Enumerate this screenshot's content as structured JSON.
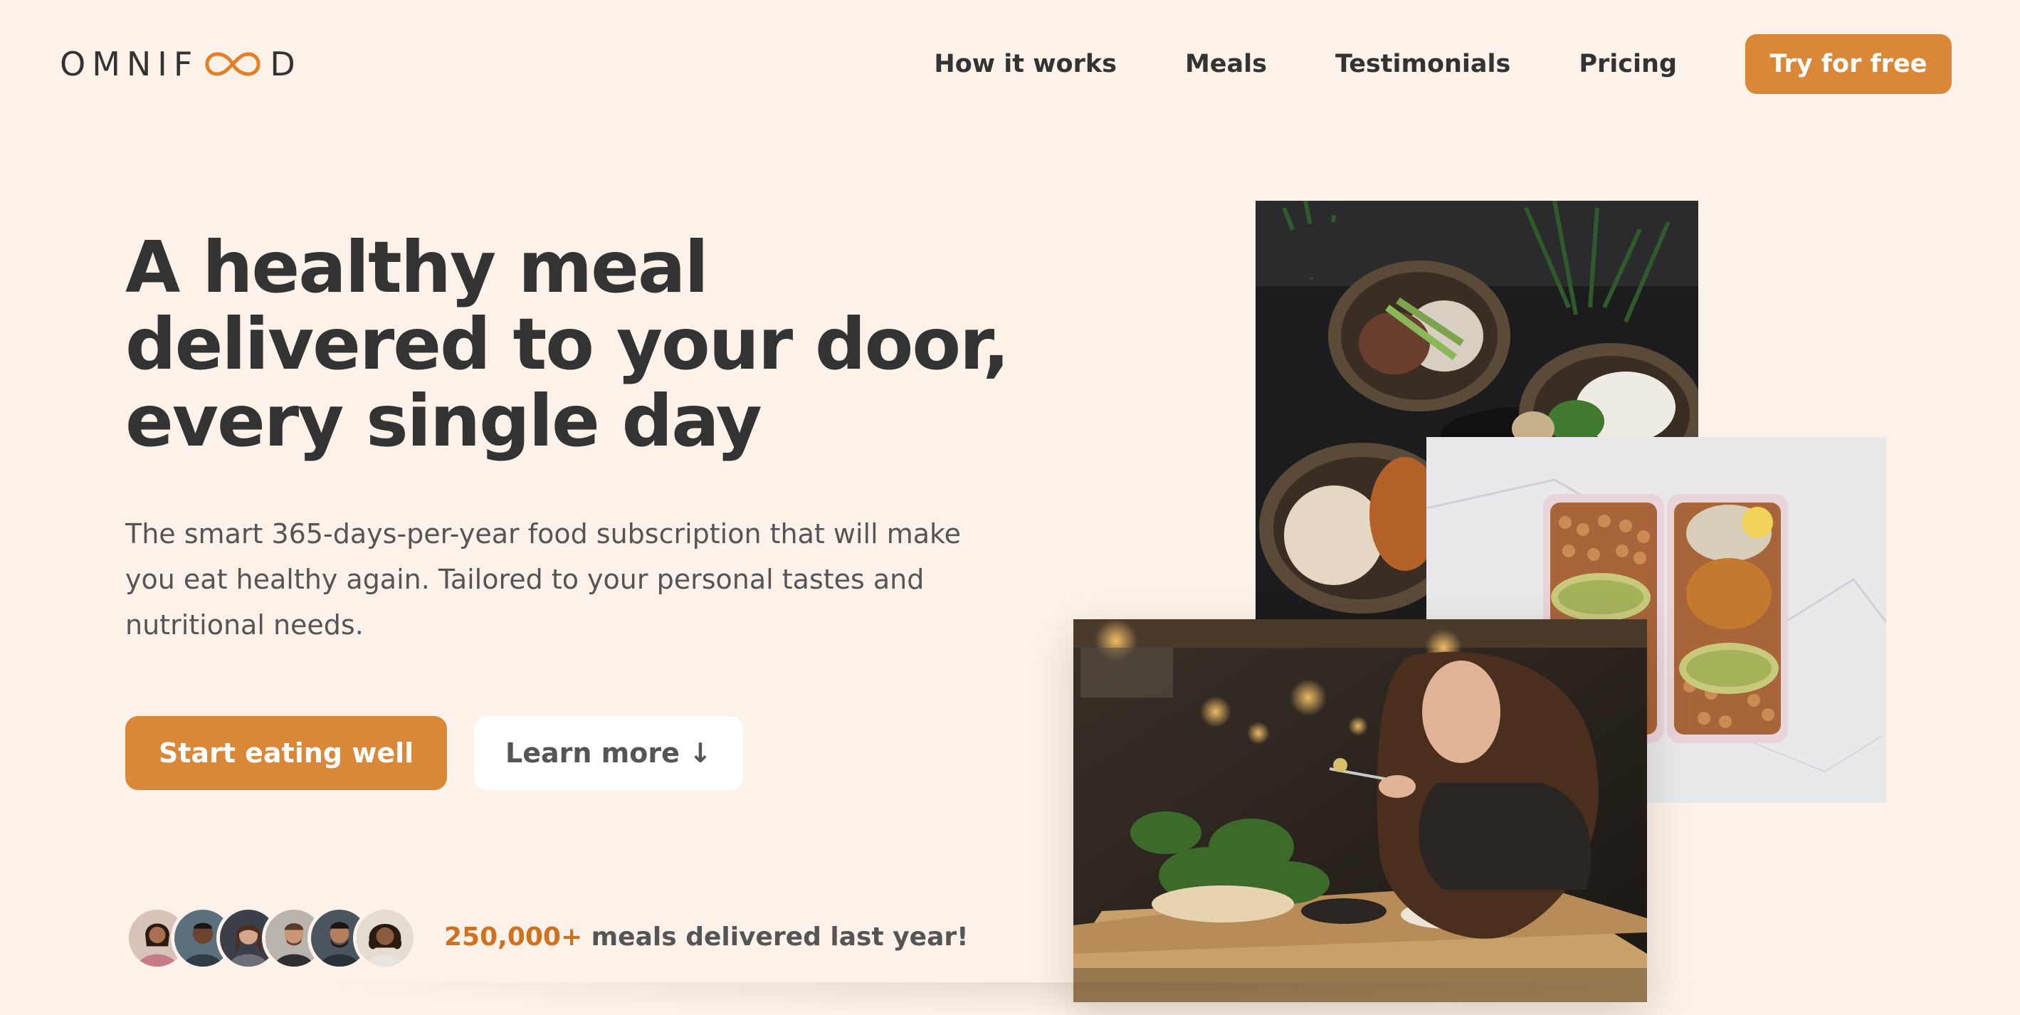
{
  "header": {
    "logo_left": "OMNIF",
    "logo_right": "D",
    "nav": [
      {
        "label": "How it works"
      },
      {
        "label": "Meals"
      },
      {
        "label": "Testimonials"
      },
      {
        "label": "Pricing"
      }
    ],
    "cta_label": "Try for free"
  },
  "hero": {
    "title": "A healthy meal delivered to your door, every single day",
    "description": "The smart 365-days-per-year food subscription that will make you eat healthy again. Tailored to your personal tastes and nutritional needs.",
    "primary_button": "Start eating well",
    "secondary_button": "Learn more ↓",
    "delivered_count": "250,000+",
    "delivered_text": " meals delivered last year!"
  },
  "colors": {
    "background": "#fdf2e9",
    "accent": "#da8737",
    "text": "#333333"
  },
  "icons": [
    "infinity-logo-icon",
    "customer-avatar"
  ]
}
